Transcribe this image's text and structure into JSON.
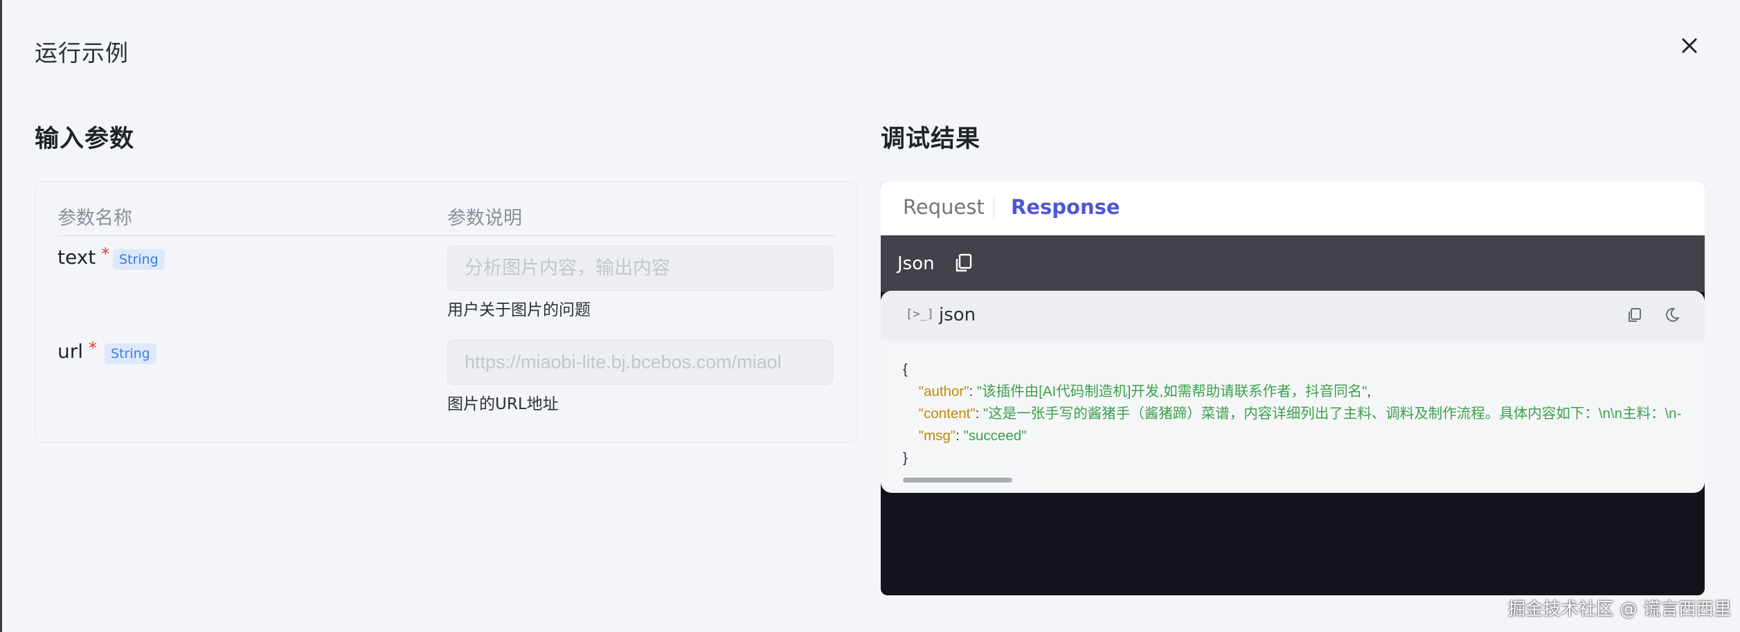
{
  "modal": {
    "title": "运行示例"
  },
  "input_section": {
    "title": "输入参数",
    "columns": {
      "name": "参数名称",
      "description": "参数说明"
    },
    "params": [
      {
        "name": "text",
        "required": "*",
        "type": "String",
        "placeholder": "分析图片内容，输出内容",
        "description": "用户关于图片的问题"
      },
      {
        "name": "url",
        "required": "*",
        "type": "String",
        "placeholder": "https://miaobi-lite.bj.bcebos.com/miaol",
        "description": "图片的URL地址"
      }
    ]
  },
  "result_section": {
    "title": "调试结果",
    "tabs": [
      "Request",
      "Response"
    ],
    "active_tab": "Response",
    "format_label": "Json",
    "code": {
      "terminal_glyph": "[>_]",
      "language": "json",
      "open_brace": "{",
      "close_brace": "}",
      "lines": [
        {
          "key": "\"author\"",
          "value": "\"该插件由[AI代码制造机]开发,如需帮助请联系作者，抖音同名\"",
          "trailing": ","
        },
        {
          "key": "\"content\"",
          "value": "\"这是一张手写的酱猪手（酱猪蹄）菜谱，内容详细列出了主料、调料及制作流程。具体内容如下：\\n\\n主料：\\n-",
          "trailing": ""
        },
        {
          "key": "\"msg\"",
          "value": "\"succeed\"",
          "trailing": ""
        }
      ]
    }
  },
  "watermark": "掘金技术社区 @ 谎言西西里",
  "icons": {
    "close": "close-icon",
    "copy": "copy-icon",
    "terminal": "terminal-icon",
    "theme": "moon-icon"
  },
  "colors": {
    "accent": "#4f56d4",
    "required": "#e03a3a",
    "json_key": "#c08a00",
    "json_string": "#3aa04a",
    "badge_bg": "#dde8fb",
    "badge_text": "#3b7ae0"
  }
}
